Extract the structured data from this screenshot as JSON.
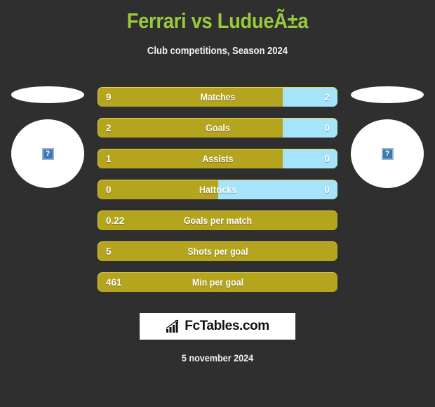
{
  "header": {
    "title": "Ferrari vs LudueÃ±a",
    "subtitle": "Club competitions, Season 2024"
  },
  "colors": {
    "background": "#2f2f2f",
    "title_green": "#9ac93a",
    "home_gold": "#b5a51e",
    "away_blue": "#a5e4fa",
    "bar_highlight": "#e8d84e",
    "text_white": "#ffffff",
    "logo_background": "#ffffff",
    "logo_text": "#111111",
    "placeholder_blue": "#3b78b4"
  },
  "players": {
    "home": {
      "photo_alt": "broken-image",
      "placeholder_glyph": "?"
    },
    "away": {
      "photo_alt": "broken-image",
      "placeholder_glyph": "?"
    }
  },
  "logo": {
    "text": "FcTables.com",
    "icon": "bar-chart-icon"
  },
  "footer": {
    "date": "5 november 2024"
  },
  "chart_data": {
    "type": "bar",
    "title": "Ferrari vs LudueÃ±a",
    "subtitle": "Club competitions, Season 2024",
    "orientation": "horizontal-diverging",
    "series": [
      {
        "name": "Ferrari",
        "color": "#b5a51e"
      },
      {
        "name": "LudueÃ±a",
        "color": "#a5e4fa"
      }
    ],
    "categories": [
      "Matches",
      "Goals",
      "Assists",
      "Hattricks",
      "Goals per match",
      "Shots per goal",
      "Min per goal"
    ],
    "rows": [
      {
        "label": "Matches",
        "home": "9",
        "away": "2",
        "home_pct": 77,
        "split": true
      },
      {
        "label": "Goals",
        "home": "2",
        "away": "0",
        "home_pct": 77,
        "split": true
      },
      {
        "label": "Assists",
        "home": "1",
        "away": "0",
        "home_pct": 77,
        "split": true
      },
      {
        "label": "Hattricks",
        "home": "0",
        "away": "0",
        "home_pct": 50,
        "split": true
      },
      {
        "label": "Goals per match",
        "home": "0.22",
        "away": "",
        "home_pct": 100,
        "split": false
      },
      {
        "label": "Shots per goal",
        "home": "5",
        "away": "",
        "home_pct": 100,
        "split": false
      },
      {
        "label": "Min per goal",
        "home": "461",
        "away": "",
        "home_pct": 100,
        "split": false
      }
    ],
    "legend_position": "none",
    "grid": false,
    "xlabel": "",
    "ylabel": ""
  }
}
